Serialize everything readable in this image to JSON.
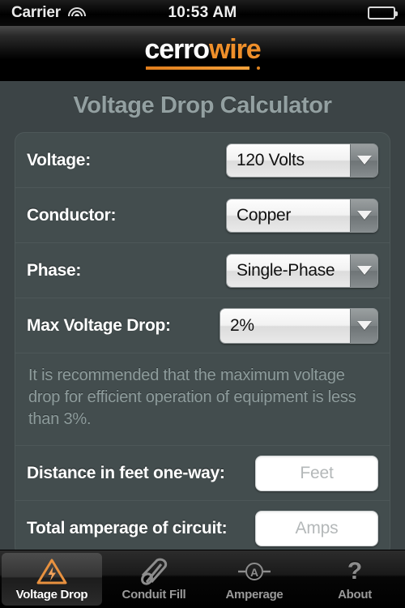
{
  "status_bar": {
    "carrier": "Carrier",
    "wifi_icon": "wifi-icon",
    "time": "10:53 AM",
    "battery_icon": "battery-icon"
  },
  "brand": {
    "name_part1": "cerro",
    "name_part2": "wire",
    "accent_color": "#ef8f2a"
  },
  "page": {
    "title": "Voltage Drop Calculator"
  },
  "form": {
    "rows": [
      {
        "label": "Voltage:",
        "value": "120 Volts",
        "control": "dropdown"
      },
      {
        "label": "Conductor:",
        "value": "Copper",
        "control": "dropdown"
      },
      {
        "label": "Phase:",
        "value": "Single-Phase",
        "control": "dropdown"
      },
      {
        "label": "Max Voltage Drop:",
        "value": "2%",
        "control": "dropdown"
      }
    ],
    "note": "It is recommended that the maximum voltage drop for efficient operation of equipment is less than 3%.",
    "inputs": [
      {
        "label": "Distance in feet one-way:",
        "placeholder": "Feet",
        "value": ""
      },
      {
        "label": "Total amperage of circuit:",
        "placeholder": "Amps",
        "value": ""
      }
    ]
  },
  "tabbar": {
    "items": [
      {
        "label": "Voltage Drop",
        "icon": "warning-bolt-icon",
        "active": true
      },
      {
        "label": "Conduit Fill",
        "icon": "conduit-pipe-icon",
        "active": false
      },
      {
        "label": "Amperage",
        "icon": "ammeter-icon",
        "active": false
      },
      {
        "label": "About",
        "icon": "question-mark-icon",
        "active": false
      }
    ]
  }
}
